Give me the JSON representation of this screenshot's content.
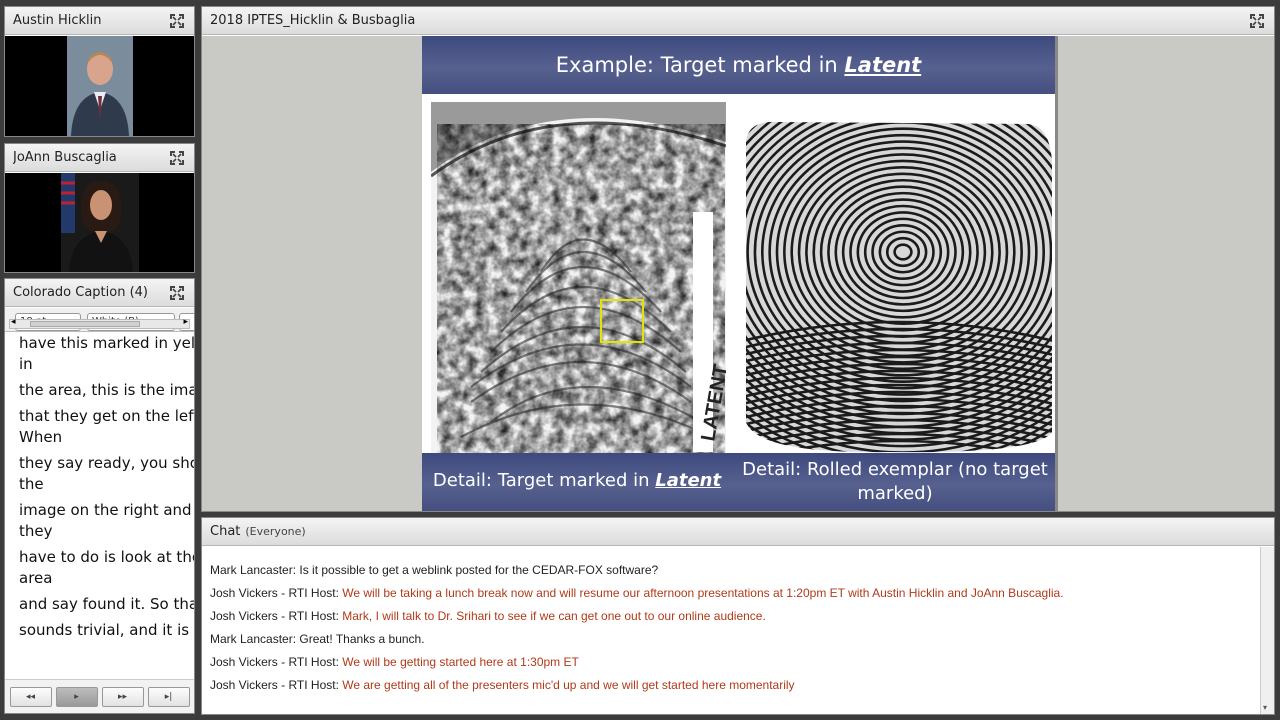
{
  "video1": {
    "title": "Austin Hicklin"
  },
  "video2": {
    "title": "JoAnn Buscaglia"
  },
  "caption": {
    "title": "Colorado Caption (4)",
    "font_size": "18 pt",
    "color": "White (B)",
    "lines": [
      [
        "have this marked in yello",
        "in"
      ],
      [
        "the area, this is the imag"
      ],
      [
        "that they get on the left.",
        "When"
      ],
      [
        "they say ready, you show",
        "the"
      ],
      [
        "image on the right and a",
        "they"
      ],
      [
        "have to do is look at the",
        "area"
      ],
      [
        "and say found it. So that"
      ],
      [
        "sounds trivial, and it is a"
      ]
    ],
    "nav": [
      "⏮",
      "▶",
      "⏭",
      "⏭|"
    ]
  },
  "share": {
    "title": "2018 IPTES_Hicklin & Busbaglia",
    "slide_title_prefix": "Example: Target marked in ",
    "slide_title_emph": "Latent",
    "left_caption_prefix": "Detail: Target marked in ",
    "left_caption_emph": "Latent",
    "right_caption": "Detail: Rolled exemplar (no target marked)"
  },
  "chat": {
    "title": "Chat",
    "audience": "(Everyone)",
    "messages": [
      {
        "who": "Mark Lancaster:",
        "text": "Is it possible to get a weblink posted for the CEDAR-FOX software?",
        "host": false
      },
      {
        "who": "Josh Vickers - RTI Host:",
        "text": "We will be taking a lunch break now and will resume our afternoon presentations at 1:20pm ET with Austin Hicklin and JoAnn Buscaglia.",
        "host": true
      },
      {
        "who": "Josh Vickers - RTI Host:",
        "text": "Mark, I will talk to Dr. Srihari to see if we can get one out to our online audience.",
        "host": true
      },
      {
        "who": "Mark Lancaster:",
        "text": "Great!  Thanks a bunch.",
        "host": false
      },
      {
        "who": "Josh Vickers - RTI Host:",
        "text": "We will be getting started here at 1:30pm ET",
        "host": true
      },
      {
        "who": "Josh Vickers - RTI Host:",
        "text": "We are getting all of the presenters mic'd up and we will get started here momentarily",
        "host": true
      }
    ]
  },
  "colors": {
    "host_text": "#b03a1a",
    "slide_band": "#4a5585"
  }
}
